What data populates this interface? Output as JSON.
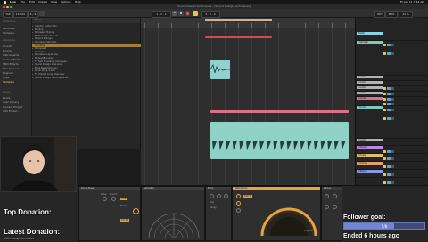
{
  "menubar": {
    "items": [
      "Live",
      "File",
      "Edit",
      "Create",
      "View",
      "Options",
      "Help"
    ],
    "datetime": "Fri Jan 11  7:44 AM"
  },
  "window": {
    "title": "Sound Design techniques - [Sound Design techniques]"
  },
  "transport": {
    "tempo": "120.00",
    "signature": "4 / 4",
    "position": "1 . 1 . 1",
    "end": "4 . 0 . 0",
    "key": "KEY",
    "midi": "MIDI",
    "cpu": "12 %"
  },
  "sidebar": {
    "collections_header": "Collections",
    "collections": [
      "Favorites",
      "Samples"
    ],
    "categories_header": "Categories",
    "categories": [
      "Sounds",
      "Drums",
      "Instruments",
      "Audio Effects",
      "MIDI Effects",
      "Max for Live",
      "Plug-ins",
      "Clips",
      "Samples"
    ],
    "places_header": "Places",
    "places": [
      "Packs",
      "User Library",
      "Current Project",
      "Add Folder..."
    ]
  },
  "browser": {
    "header_name": "Name",
    "rows": [
      {
        "label": "Ableton Folder Info",
        "sel": false
      },
      {
        "label": "Backup",
        "sel": false
      },
      {
        "label": "Packages Mixing",
        "sel": false
      },
      {
        "label": "Multisample Sounds",
        "sel": false
      },
      {
        "label": "Project Mixings",
        "sel": false
      },
      {
        "label": "Rendered Samples",
        "sel": false
      },
      {
        "label": "Samples",
        "sel": true
      },
      {
        "label": "Processed",
        "sel": false
      },
      {
        "label": "Recorded",
        "sel": false
      },
      {
        "label": "Rendered Layer.wav",
        "sel": false
      },
      {
        "label": "RedeyeBus.wav",
        "sel": false
      },
      {
        "label": "T3 Sub Slowdrop rising.wav",
        "sel": false
      },
      {
        "label": "Sound Design loop.wav",
        "sel": false
      },
      {
        "label": "Bass Resample.wav",
        "sel": false
      },
      {
        "label": "Vocal Chop 1.wav",
        "sel": false
      },
      {
        "label": "FX Impact Long Riser.wav",
        "sel": false
      },
      {
        "label": "Sound Design techniques.als",
        "sel": false
      }
    ]
  },
  "tracks": {
    "items": [
      {
        "name": "Master",
        "color": "#8ad3e0"
      },
      {
        "name": "1 Sampler",
        "color": "#7fc9c0"
      },
      {
        "name": "2 Audio",
        "color": "#b4b4b4"
      },
      {
        "name": "3 Audio",
        "color": "#b4b4b4"
      },
      {
        "name": "4 Audio",
        "color": "#b4b4b4"
      },
      {
        "name": "5 Audio",
        "color": "#b4b4b4"
      },
      {
        "name": "6 Vocals",
        "color": "#e06f8b"
      },
      {
        "name": "7 Drums",
        "color": "#7fc9c0"
      },
      {
        "name": "8 Audio",
        "color": "#b4b4b4"
      },
      {
        "name": "A Reverb",
        "color": "#b98ae0"
      },
      {
        "name": "B Delay",
        "color": "#e0c06f"
      },
      {
        "name": "C Chorus",
        "color": "#e0a06f"
      },
      {
        "name": "D Return",
        "color": "#8a9ae0"
      }
    ]
  },
  "devices": {
    "panel1_title": "Drum Buss",
    "panel2_title": "Saturator",
    "panel3_title": "Echo",
    "panel4_title": "Resonators",
    "panel5_title": "Redux",
    "param_drive": "Drive",
    "param_crunch": "Crunch",
    "param_boom": "Boom",
    "param_freq": "Freq",
    "param_decay": "Decay",
    "param_dry_wet": "Dry/Wet",
    "value_a": "1.00",
    "value_b": "0.0 dB",
    "value_c": "100 %"
  },
  "overlays": {
    "top_donation": "Top Donation:",
    "latest_donation": "Latest Donation:",
    "latest_donation_sub": "Sound Design techniques",
    "follower_goal": "Follower goal:",
    "goal_count": "5/8",
    "goal_fraction": 0.625,
    "ended": "Ended 6 hours ago"
  }
}
